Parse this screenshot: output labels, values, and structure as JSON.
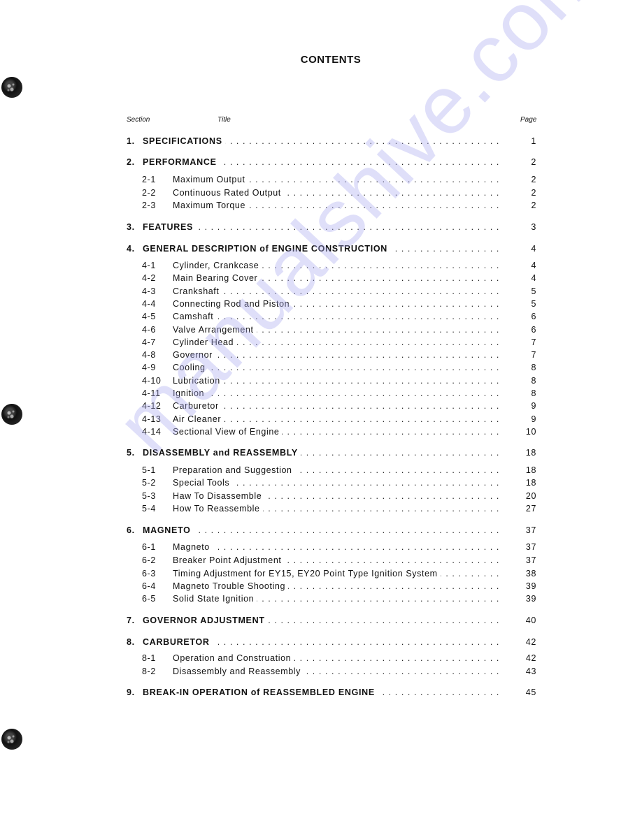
{
  "page_title": "CONTENTS",
  "column_headers": {
    "section": "Section",
    "title": "Title",
    "page": "Page"
  },
  "watermark": "manualshive.com",
  "entries": [
    {
      "num": "1.",
      "title": "SPECIFICATIONS",
      "page": "1",
      "level": "main"
    },
    {
      "num": "2.",
      "title": "PERFORMANCE",
      "page": "2",
      "level": "main"
    },
    {
      "num": "2-1",
      "title": "Maximum Output",
      "page": "2",
      "level": "sub"
    },
    {
      "num": "2-2",
      "title": "Continuous Rated Output",
      "page": "2",
      "level": "sub"
    },
    {
      "num": "2-3",
      "title": "Maximum Torque",
      "page": "2",
      "level": "sub"
    },
    {
      "num": "3.",
      "title": "FEATURES",
      "page": "3",
      "level": "main"
    },
    {
      "num": "4.",
      "title": "GENERAL DESCRIPTION of ENGINE CONSTRUCTION",
      "page": "4",
      "level": "main"
    },
    {
      "num": "4-1",
      "title": "Cylinder, Crankcase",
      "page": "4",
      "level": "sub"
    },
    {
      "num": "4-2",
      "title": "Main Bearing Cover",
      "page": "4",
      "level": "sub"
    },
    {
      "num": "4-3",
      "title": "Crankshaft",
      "page": "5",
      "level": "sub"
    },
    {
      "num": "4-4",
      "title": "Connecting Rod and Piston",
      "page": "5",
      "level": "sub"
    },
    {
      "num": "4-5",
      "title": "Camshaft",
      "page": "6",
      "level": "sub"
    },
    {
      "num": "4-6",
      "title": "Valve Arrangement",
      "page": "6",
      "level": "sub"
    },
    {
      "num": "4-7",
      "title": "Cylinder Head",
      "page": "7",
      "level": "sub"
    },
    {
      "num": "4-8",
      "title": "Governor",
      "page": "7",
      "level": "sub"
    },
    {
      "num": "4-9",
      "title": "Cooling",
      "page": "8",
      "level": "sub"
    },
    {
      "num": "4-10",
      "title": "Lubrication",
      "page": "8",
      "level": "sub"
    },
    {
      "num": "4-11",
      "title": "Ignition",
      "page": "8",
      "level": "sub"
    },
    {
      "num": "4-12",
      "title": "Carburetor",
      "page": "9",
      "level": "sub"
    },
    {
      "num": "4-13",
      "title": "Air Cleaner",
      "page": "9",
      "level": "sub"
    },
    {
      "num": "4-14",
      "title": "Sectional View of Engine",
      "page": "10",
      "level": "sub"
    },
    {
      "num": "5.",
      "title": "DISASSEMBLY and REASSEMBLY",
      "page": "18",
      "level": "main"
    },
    {
      "num": "5-1",
      "title": "Preparation and Suggestion",
      "page": "18",
      "level": "sub"
    },
    {
      "num": "5-2",
      "title": "Special Tools",
      "page": "18",
      "level": "sub"
    },
    {
      "num": "5-3",
      "title": "Haw To Disassemble",
      "page": "20",
      "level": "sub"
    },
    {
      "num": "5-4",
      "title": "How To Reassemble",
      "page": "27",
      "level": "sub"
    },
    {
      "num": "6.",
      "title": "MAGNETO",
      "page": "37",
      "level": "main"
    },
    {
      "num": "6-1",
      "title": "Magneto",
      "page": "37",
      "level": "sub"
    },
    {
      "num": "6-2",
      "title": "Breaker Point Adjustment",
      "page": "37",
      "level": "sub"
    },
    {
      "num": "6-3",
      "title": "Timing Adjustment for EY15, EY20 Point Type Ignition System",
      "page": "38",
      "level": "sub"
    },
    {
      "num": "6-4",
      "title": "Magneto Trouble Shooting",
      "page": "39",
      "level": "sub"
    },
    {
      "num": "6-5",
      "title": "Solid State Ignition",
      "page": "39",
      "level": "sub"
    },
    {
      "num": "7.",
      "title": "GOVERNOR ADJUSTMENT",
      "page": "40",
      "level": "main"
    },
    {
      "num": "8.",
      "title": "CARBURETOR",
      "page": "42",
      "level": "main"
    },
    {
      "num": "8-1",
      "title": "Operation and Construation",
      "page": "42",
      "level": "sub"
    },
    {
      "num": "8-2",
      "title": "Disassembly and Reassembly",
      "page": "43",
      "level": "sub"
    },
    {
      "num": "9.",
      "title": "BREAK-IN OPERATION of REASSEMBLED ENGINE",
      "page": "45",
      "level": "main"
    }
  ]
}
